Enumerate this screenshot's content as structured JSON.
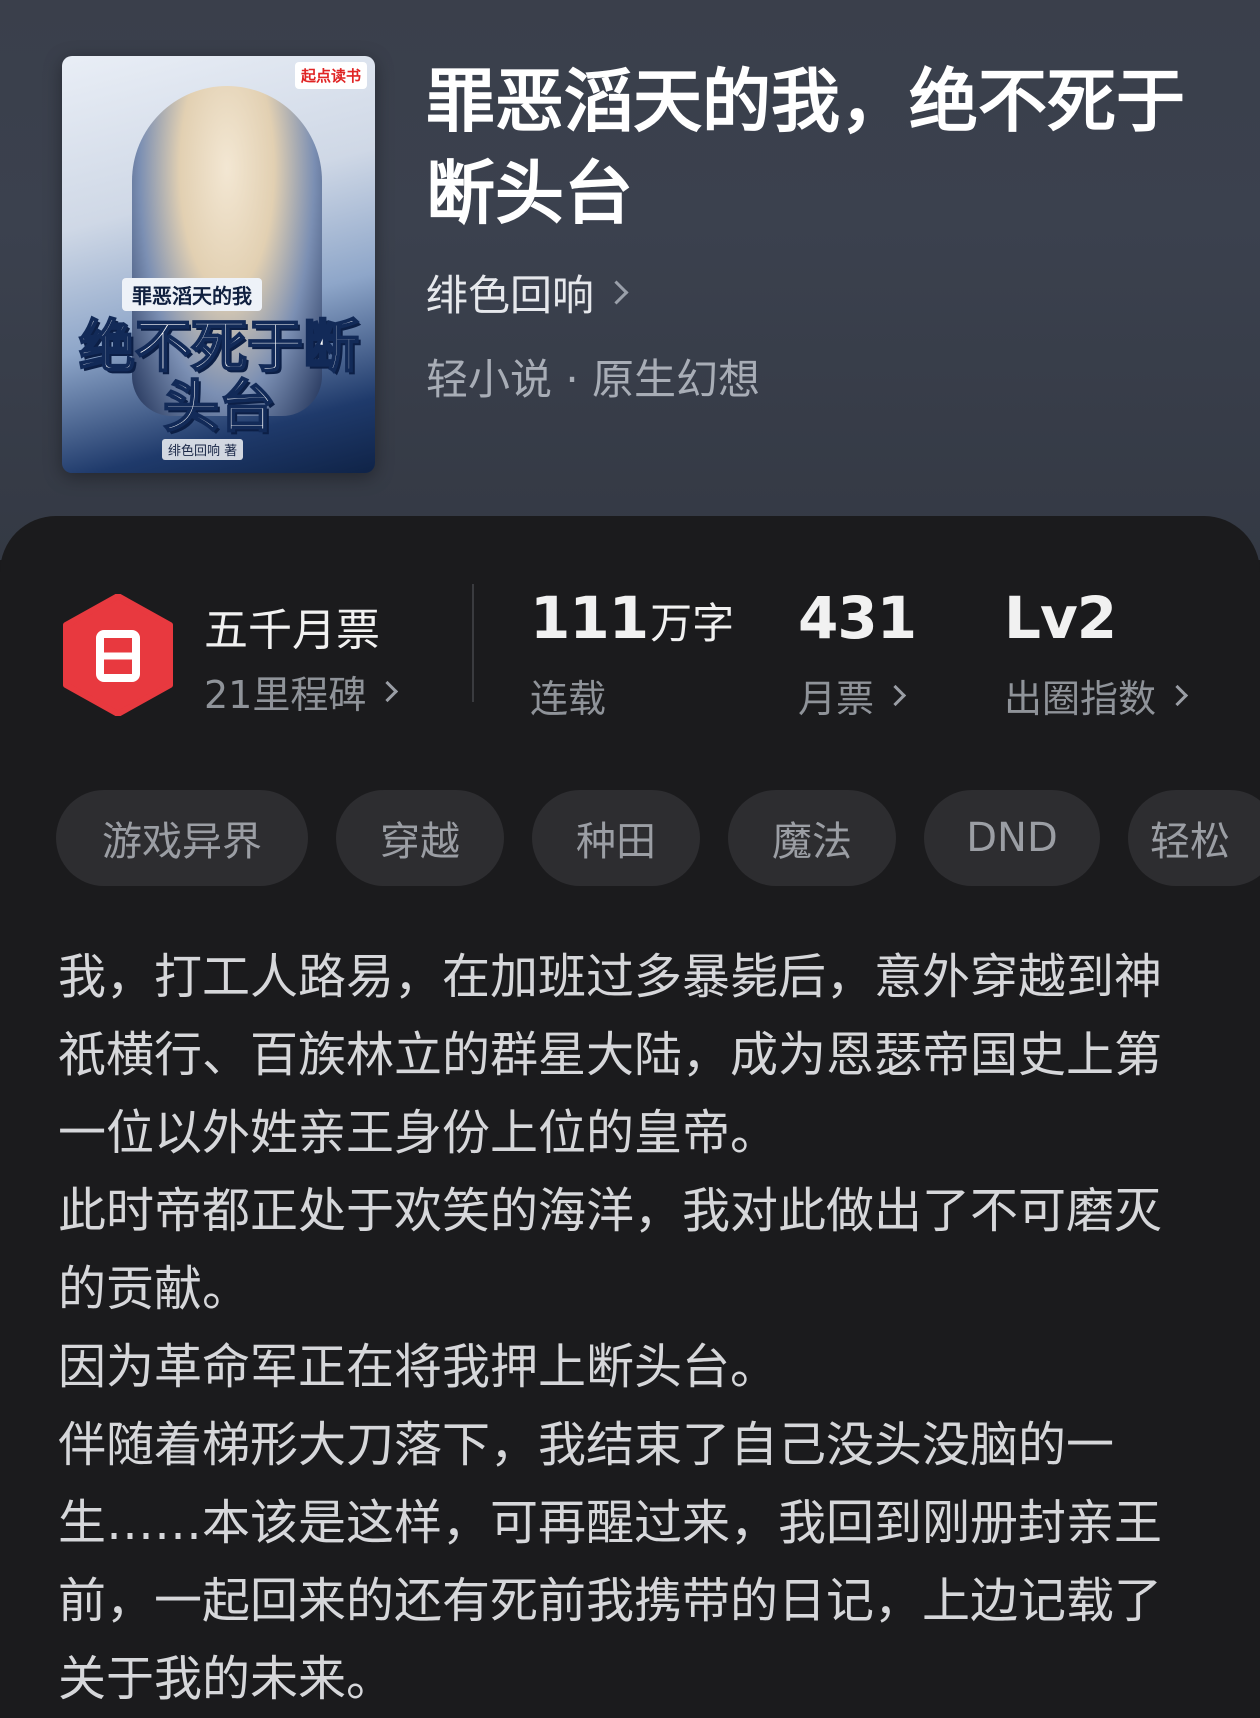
{
  "book": {
    "title": "罪恶滔天的我，绝不死于断头台",
    "author": "绯色回响",
    "genre": "轻小说 · 原生幻想"
  },
  "cover": {
    "publisher_logo": "起点读书",
    "subtitle": "罪恶滔天的我",
    "title": "绝不死于断头台",
    "author": "绯色回响 著"
  },
  "stats": {
    "ticket": {
      "title": "五千月票",
      "milestone": "21里程碑",
      "icon": "ticket-badge-icon",
      "color": "#e8393f"
    },
    "words": {
      "value": "111",
      "unit": "万字",
      "status": "连载"
    },
    "monthly_votes": {
      "value": "431",
      "label": "月票"
    },
    "popularity": {
      "value": "Lv2",
      "label": "出圈指数"
    }
  },
  "tags": [
    "游戏异界",
    "穿越",
    "种田",
    "魔法",
    "DND",
    "轻松"
  ],
  "synopsis": [
    "我，打工人路易，在加班过多暴毙后，意外穿越到神祇横行、百族林立的群星大陆，成为恩瑟帝国史上第一位以外姓亲王身份上位的皇帝。",
    "此时帝都正处于欢笑的海洋，我对此做出了不可磨灭的贡献。",
    "因为革命军正在将我押上断头台。",
    "伴随着梯形大刀落下，我结束了自己没头没脑的一生……本该是这样，可再醒过来，我回到刚册封亲王前，一起回来的还有死前我携带的日记，上边记载了关于我的未来。"
  ]
}
